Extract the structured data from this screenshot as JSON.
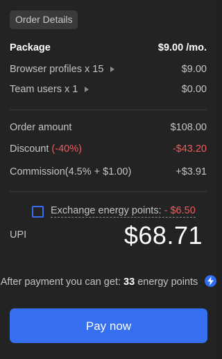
{
  "header": {
    "chip_label": "Order Details"
  },
  "package": {
    "label": "Package",
    "price": "$9.00 /mo.",
    "items": [
      {
        "label": "Browser profiles x 15",
        "price": "$9.00"
      },
      {
        "label": "Team users x 1",
        "price": "$0.00"
      }
    ]
  },
  "summary": {
    "order_amount_label": "Order amount",
    "order_amount_value": "$108.00",
    "discount_label": "Discount",
    "discount_pct": "(-40%)",
    "discount_value": "-$43.20",
    "commission_label": "Commission(4.5% + $1.00)",
    "commission_value": "+$3.91"
  },
  "exchange": {
    "label": "Exchange energy points:",
    "value": "- $6.50",
    "checked": false
  },
  "total": {
    "label": "UPI",
    "value": "$68.71"
  },
  "reward": {
    "prefix": "After payment you can get:",
    "points": "33",
    "suffix": "energy points"
  },
  "actions": {
    "pay_label": "Pay now"
  },
  "colors": {
    "accent": "#3670f0",
    "negative": "#f05b5b",
    "background": "#232323"
  }
}
